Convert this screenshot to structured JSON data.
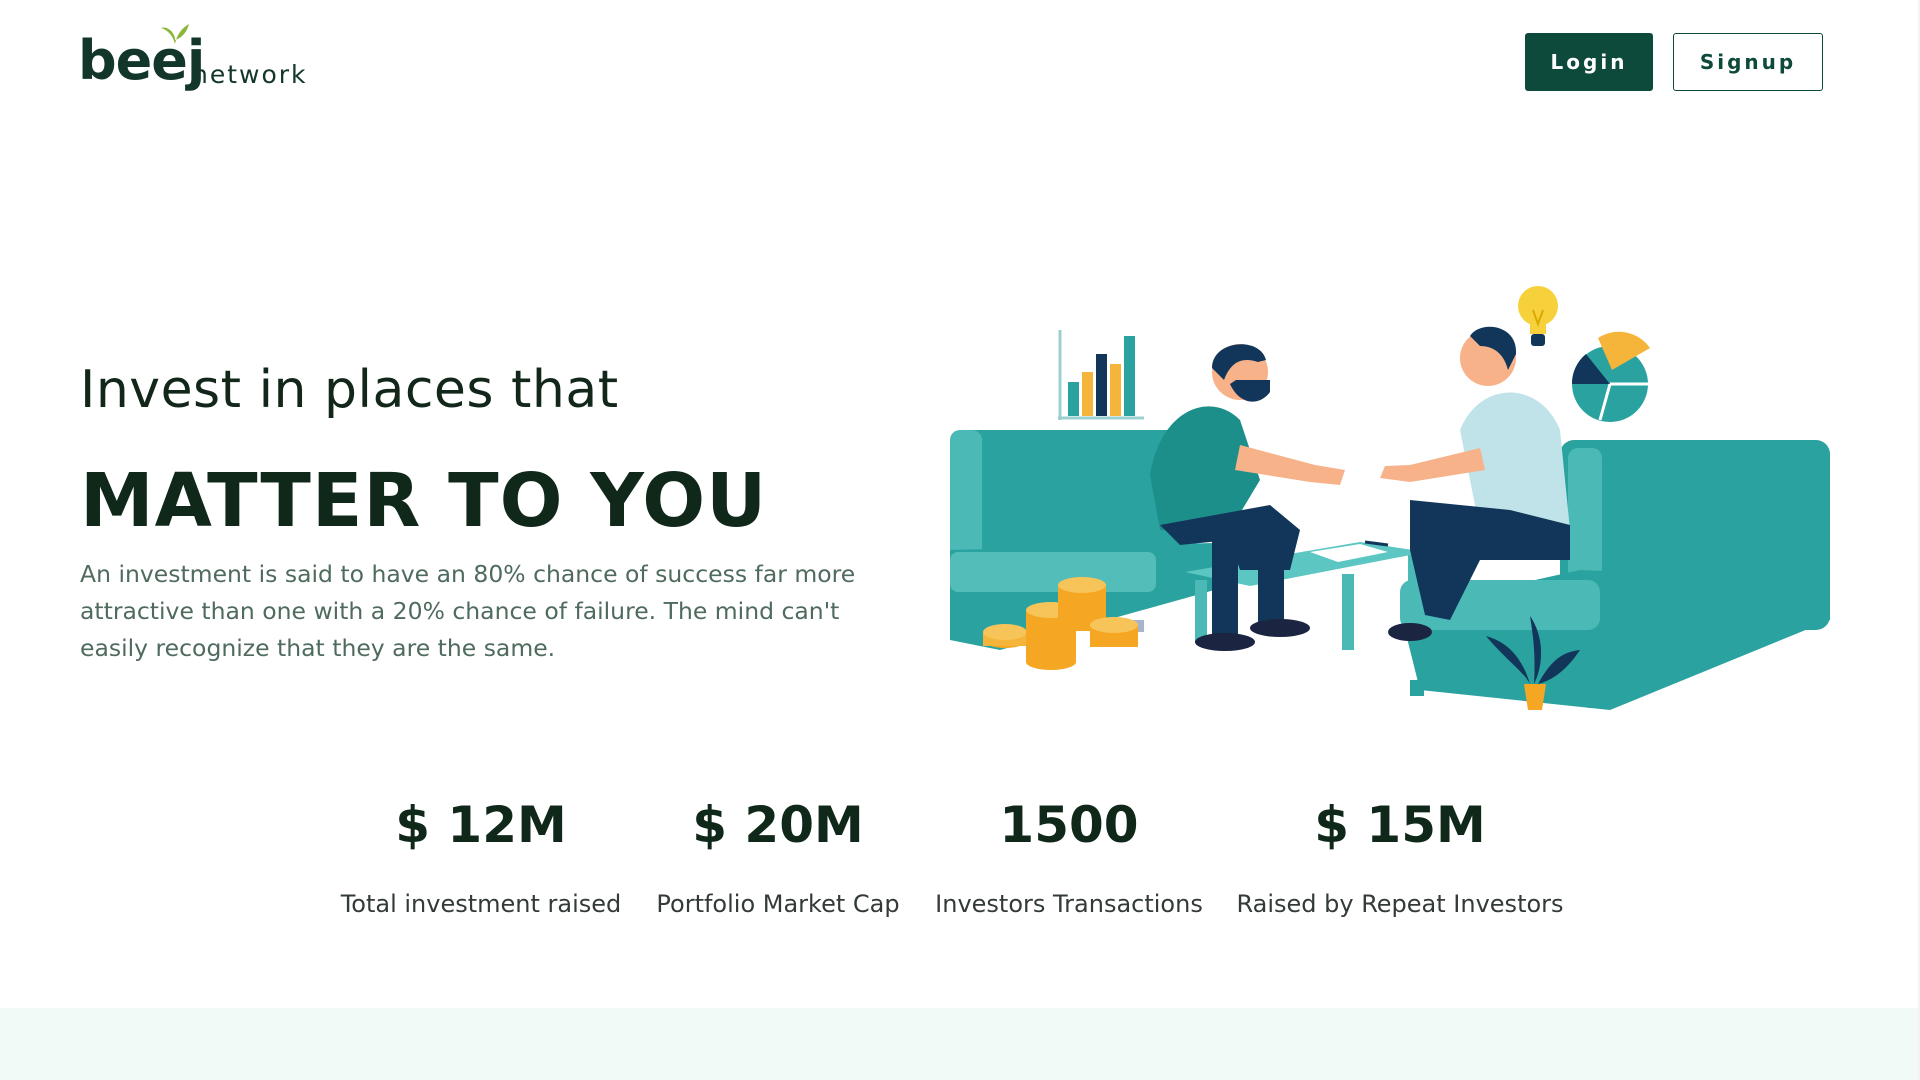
{
  "header": {
    "logo_main": "beej",
    "logo_sub": "network",
    "login_label": "Login",
    "signup_label": "Signup"
  },
  "hero": {
    "kicker": "Invest in places that",
    "headline": "MATTER TO YOU",
    "description": "An investment is said to have an 80% chance of success far more attractive than one with a 20% chance of failure. The mind can't easily recognize that they are the same."
  },
  "stats": [
    {
      "value": "$ 12M",
      "label": "Total investment raised"
    },
    {
      "value": "$ 20M",
      "label": "Portfolio Market Cap"
    },
    {
      "value": "1500",
      "label": "Investors Transactions"
    },
    {
      "value": "$ 15M",
      "label": "Raised by Repeat Investors"
    }
  ],
  "colors": {
    "brand_dark": "#0e4a3c",
    "teal": "#2aa3a0",
    "accent_yellow": "#f5b53a",
    "footer_band": "#f1faf7"
  },
  "icons": [
    "leaf-icon",
    "bar-chart-icon",
    "lightbulb-icon",
    "pie-chart-icon",
    "coins-icon",
    "plant-icon"
  ]
}
